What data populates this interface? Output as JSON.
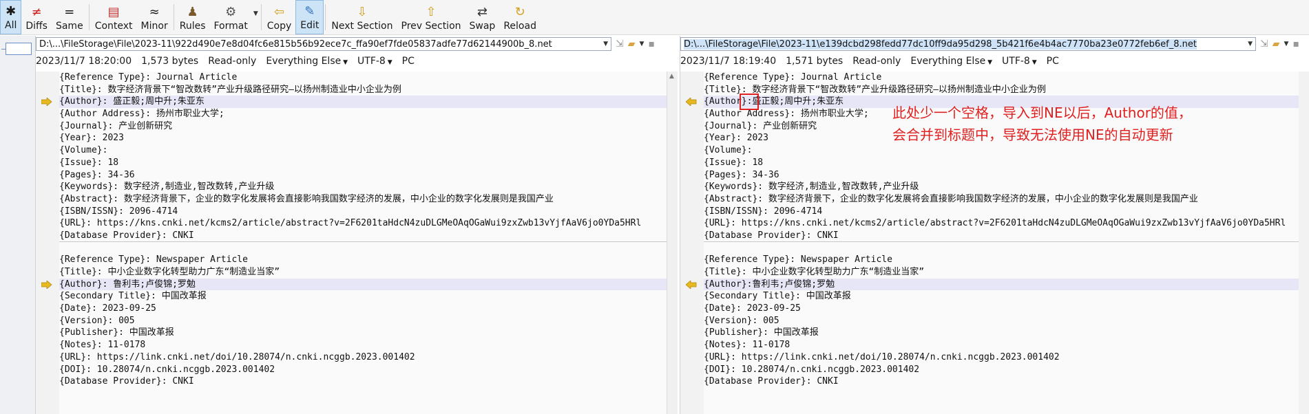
{
  "toolbar": {
    "buttons": [
      {
        "label": "All",
        "icon": "asterisk-icon",
        "glyph": "✱",
        "color": "#1a1a1a",
        "active": true
      },
      {
        "label": "Diffs",
        "icon": "not-equal-icon",
        "glyph": "≠",
        "color": "#d02020"
      },
      {
        "label": "Same",
        "icon": "equal-icon",
        "glyph": "=",
        "color": "#1a1a1a"
      },
      {
        "label": "Context",
        "icon": "context-icon",
        "glyph": "▤",
        "color": "#c03030"
      },
      {
        "label": "Minor",
        "icon": "approx-icon",
        "glyph": "≈",
        "color": "#1a1a1a"
      },
      {
        "label": "Rules",
        "icon": "rules-person-icon",
        "glyph": "♟",
        "color": "#7a5a2a"
      },
      {
        "label": "Format",
        "icon": "format-gear-icon",
        "glyph": "⚙",
        "color": "#555555"
      },
      {
        "label": "Copy",
        "icon": "copy-arrow-left-icon",
        "glyph": "⇦",
        "color": "#d4a020"
      },
      {
        "label": "Edit",
        "icon": "edit-pencil-icon",
        "glyph": "✎",
        "color": "#3070c0",
        "active": true
      },
      {
        "label": "Next Section",
        "icon": "next-section-icon",
        "glyph": "⇩",
        "color": "#d4a020"
      },
      {
        "label": "Prev Section",
        "icon": "prev-section-icon",
        "glyph": "⇧",
        "color": "#d4a020"
      },
      {
        "label": "Swap",
        "icon": "swap-icon",
        "glyph": "⇄",
        "color": "#333333"
      },
      {
        "label": "Reload",
        "icon": "reload-icon",
        "glyph": "↻",
        "color": "#d4a020"
      }
    ]
  },
  "left": {
    "path": "D:\\...\\FileStorage\\File\\2023-11\\922d490e7e8d04fc6e815b56b92ece7c_ffa90ef7fde05837adfe77d62144900b_8.net",
    "info": {
      "datetime": "2023/11/7 18:20:00",
      "size": "1,573 bytes",
      "mode": "Read-only",
      "filter": "Everything Else",
      "encoding": "UTF-8",
      "eol": "PC"
    },
    "lines": [
      "{Reference Type}: Journal Article",
      "{Title}: 数字经济背景下“智改数转”产业升级路径研究—以扬州制造业中小企业为例",
      "{Author}: 盛正毅;周中升;朱亚东",
      "{Author Address}: 扬州市职业大学;",
      "{Journal}: 产业创新研究",
      "{Year}: 2023",
      "{Volume}:",
      "{Issue}: 18",
      "{Pages}: 34-36",
      "{Keywords}: 数字经济,制造业,智改数转,产业升级",
      "{Abstract}: 数字经济背景下，企业的数字化发展将会直接影响我国数字经济的发展，中小企业的数字化发展则是我国产业",
      "{ISBN/ISSN}: 2096-4714",
      "{URL}: https://kns.cnki.net/kcms2/article/abstract?v=2F6201taHdcN4zuDLGMeOAqOGaWui9zxZwb13vYjfAaV6jo0YDa5HRl",
      "{Database Provider}: CNKI",
      "",
      "{Reference Type}: Newspaper Article",
      "{Title}: 中小企业数字化转型助力广东“制造业当家”",
      "{Author}: 鲁利韦;卢俊锦;罗勉",
      "{Secondary Title}: 中国改革报",
      "{Date}: 2023-09-25",
      "{Version}: 005",
      "{Publisher}: 中国改革报",
      "{Notes}: 11-0178",
      "{URL}: https://link.cnki.net/doi/10.28074/n.cnki.ncggb.2023.001402",
      "{DOI}: 10.28074/n.cnki.ncggb.2023.001402",
      "{Database Provider}: CNKI"
    ]
  },
  "right": {
    "path": "D:\\...\\FileStorage\\File\\2023-11\\e139dcbd298fedd77dc10ff9da95d298_5b421f6e4b4ac7770ba23e0772feb6ef_8.net",
    "info": {
      "datetime": "2023/11/7 18:19:40",
      "size": "1,571 bytes",
      "mode": "Read-only",
      "filter": "Everything Else",
      "encoding": "UTF-8",
      "eol": "PC"
    },
    "lines": [
      "{Reference Type}: Journal Article",
      "{Title}: 数字经济背景下“智改数转”产业升级路径研究—以扬州制造业中小企业为例",
      "{Author}:盛正毅;周中升;朱亚东",
      "{Author Address}: 扬州市职业大学;",
      "{Journal}: 产业创新研究",
      "{Year}: 2023",
      "{Volume}:",
      "{Issue}: 18",
      "{Pages}: 34-36",
      "{Keywords}: 数字经济,制造业,智改数转,产业升级",
      "{Abstract}: 数字经济背景下，企业的数字化发展将会直接影响我国数字经济的发展，中小企业的数字化发展则是我国产业",
      "{ISBN/ISSN}: 2096-4714",
      "{URL}: https://kns.cnki.net/kcms2/article/abstract?v=2F6201taHdcN4zuDLGMeOAqOGaWui9zxZwb13vYjfAaV6jo0YDa5HRl",
      "{Database Provider}: CNKI",
      "",
      "{Reference Type}: Newspaper Article",
      "{Title}: 中小企业数字化转型助力广东“制造业当家”",
      "{Author}:鲁利韦;卢俊锦;罗勉",
      "{Secondary Title}: 中国改革报",
      "{Date}: 2023-09-25",
      "{Version}: 005",
      "{Publisher}: 中国改革报",
      "{Notes}: 11-0178",
      "{URL}: https://link.cnki.net/doi/10.28074/n.cnki.ncggb.2023.001402",
      "{DOI}: 10.28074/n.cnki.ncggb.2023.001402",
      "{Database Provider}: CNKI"
    ]
  },
  "diff_lines": [
    2,
    17
  ],
  "annotation": {
    "text_line1": "此处少一个空格，导入到NE以后，Author的值，",
    "text_line2": "会合并到标题中，导致无法使用NE的自动更新",
    "color": "#e02020"
  },
  "colors": {
    "diff_bg": "#e6e6f6",
    "arrow": "#e8b820",
    "accent": "#3070c0"
  }
}
